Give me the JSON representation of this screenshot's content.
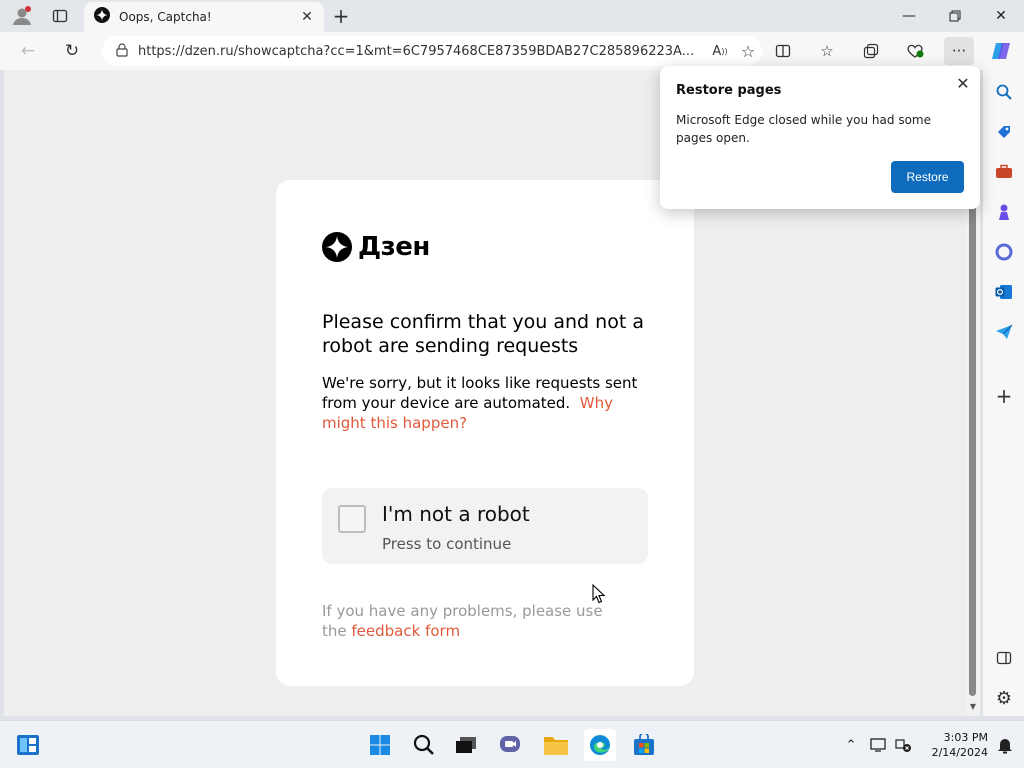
{
  "browser": {
    "tab": {
      "title": "Oops, Captcha!"
    },
    "address": {
      "url": "https://dzen.ru/showcaptcha?cc=1&mt=6C7957468CE87359BDAB27C285896223A..."
    },
    "icons": {
      "profile": "profile-icon",
      "tab_actions": "tab-actions-icon",
      "back": "back-icon",
      "refresh": "refresh-icon",
      "lock": "lock-icon",
      "read_aloud": "read-aloud-icon",
      "favorite": "star-icon",
      "split_screen": "split-screen-icon",
      "favorites": "favorites-icon",
      "collections": "collections-icon",
      "performance": "performance-icon",
      "more": "more-icon",
      "copilot": "copilot-icon"
    }
  },
  "popup": {
    "title": "Restore pages",
    "message": "Microsoft Edge closed while you had some pages open.",
    "button": "Restore"
  },
  "page": {
    "logo_text": "Дзен",
    "heading": "Please confirm that you and not a robot are sending requests",
    "description": "We're sorry, but it looks like requests sent from your device are automated.",
    "why_link": "Why might this happen?",
    "captcha": {
      "label": "I'm not a robot",
      "sublabel": "Press to continue"
    },
    "problems_text": "If you have any problems, please use the",
    "feedback_link": "feedback form"
  },
  "taskbar": {
    "time": "3:03 PM",
    "date": "2/14/2024"
  },
  "colors": {
    "accent_red": "#e05a3b",
    "edge_blue": "#0f6cbd"
  }
}
